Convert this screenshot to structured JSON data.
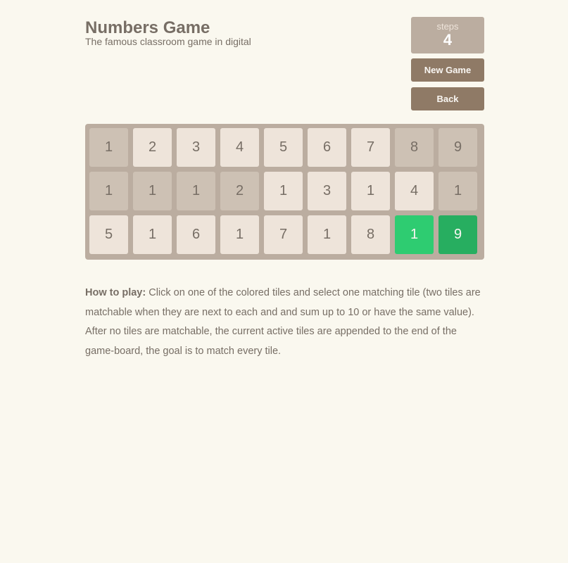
{
  "header": {
    "title": "Numbers Game",
    "subtitle": "The famous classroom game in digital"
  },
  "score": {
    "label": "steps",
    "value": "4"
  },
  "buttons": {
    "new_game": "New Game",
    "back": "Back"
  },
  "board": {
    "columns": 9,
    "rows": [
      [
        {
          "value": "1",
          "state": "matched"
        },
        {
          "value": "2",
          "state": "active"
        },
        {
          "value": "3",
          "state": "active"
        },
        {
          "value": "4",
          "state": "active"
        },
        {
          "value": "5",
          "state": "active"
        },
        {
          "value": "6",
          "state": "active"
        },
        {
          "value": "7",
          "state": "active"
        },
        {
          "value": "8",
          "state": "matched"
        },
        {
          "value": "9",
          "state": "matched"
        }
      ],
      [
        {
          "value": "1",
          "state": "matched"
        },
        {
          "value": "1",
          "state": "matched"
        },
        {
          "value": "1",
          "state": "matched"
        },
        {
          "value": "2",
          "state": "matched"
        },
        {
          "value": "1",
          "state": "active"
        },
        {
          "value": "3",
          "state": "active"
        },
        {
          "value": "1",
          "state": "active"
        },
        {
          "value": "4",
          "state": "active"
        },
        {
          "value": "1",
          "state": "matched"
        }
      ],
      [
        {
          "value": "5",
          "state": "active"
        },
        {
          "value": "1",
          "state": "active"
        },
        {
          "value": "6",
          "state": "active"
        },
        {
          "value": "1",
          "state": "active"
        },
        {
          "value": "7",
          "state": "active"
        },
        {
          "value": "1",
          "state": "active"
        },
        {
          "value": "8",
          "state": "active"
        },
        {
          "value": "1",
          "state": "selected"
        },
        {
          "value": "9",
          "state": "partner"
        }
      ]
    ]
  },
  "colors": {
    "background": "#faf8ef",
    "board": "#bbada0",
    "tile_active": "#eee4da",
    "tile_matched": "#cdc1b4",
    "tile_selected": "#2ecc71",
    "tile_partner": "#27ae60",
    "button": "#8f7a66",
    "text": "#776e65"
  },
  "instructions": {
    "heading": "How to play:",
    "body": " Click on one of the colored tiles and select one matching tile (two tiles are matchable when they are next to each and and sum up to 10 or have the same value). After no tiles are matchable, the current active tiles are appended to the end of the game-board, the goal is to match every tile."
  }
}
